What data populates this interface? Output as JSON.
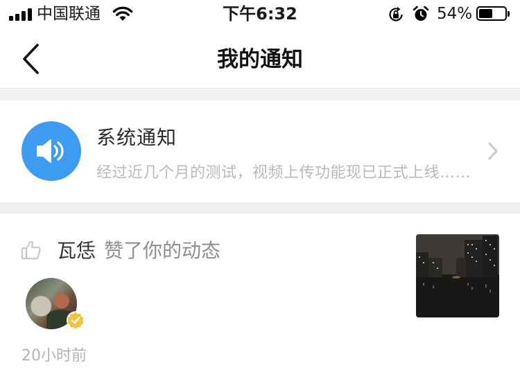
{
  "status_bar": {
    "carrier": "中国联通",
    "time": "下午6:32",
    "battery_percent_text": "54%",
    "battery_level": 0.54,
    "icons": [
      "signal-icon",
      "wifi-icon",
      "rotation-lock-icon",
      "alarm-icon",
      "battery-icon"
    ]
  },
  "nav": {
    "title": "我的通知",
    "back_icon": "back-chevron-icon"
  },
  "system_notice": {
    "title": "系统通知",
    "preview": "经过近几个月的测试，视频上传功能现已正式上线……",
    "icon": "speaker-icon",
    "accent": "#3d9bf2"
  },
  "like_notice": {
    "user": "瓦恁",
    "action": "赞了你的动态",
    "time": "20小时前",
    "icons": [
      "thumbs-up-icon",
      "verified-badge-icon"
    ],
    "badge_color": "#f5c33b"
  }
}
